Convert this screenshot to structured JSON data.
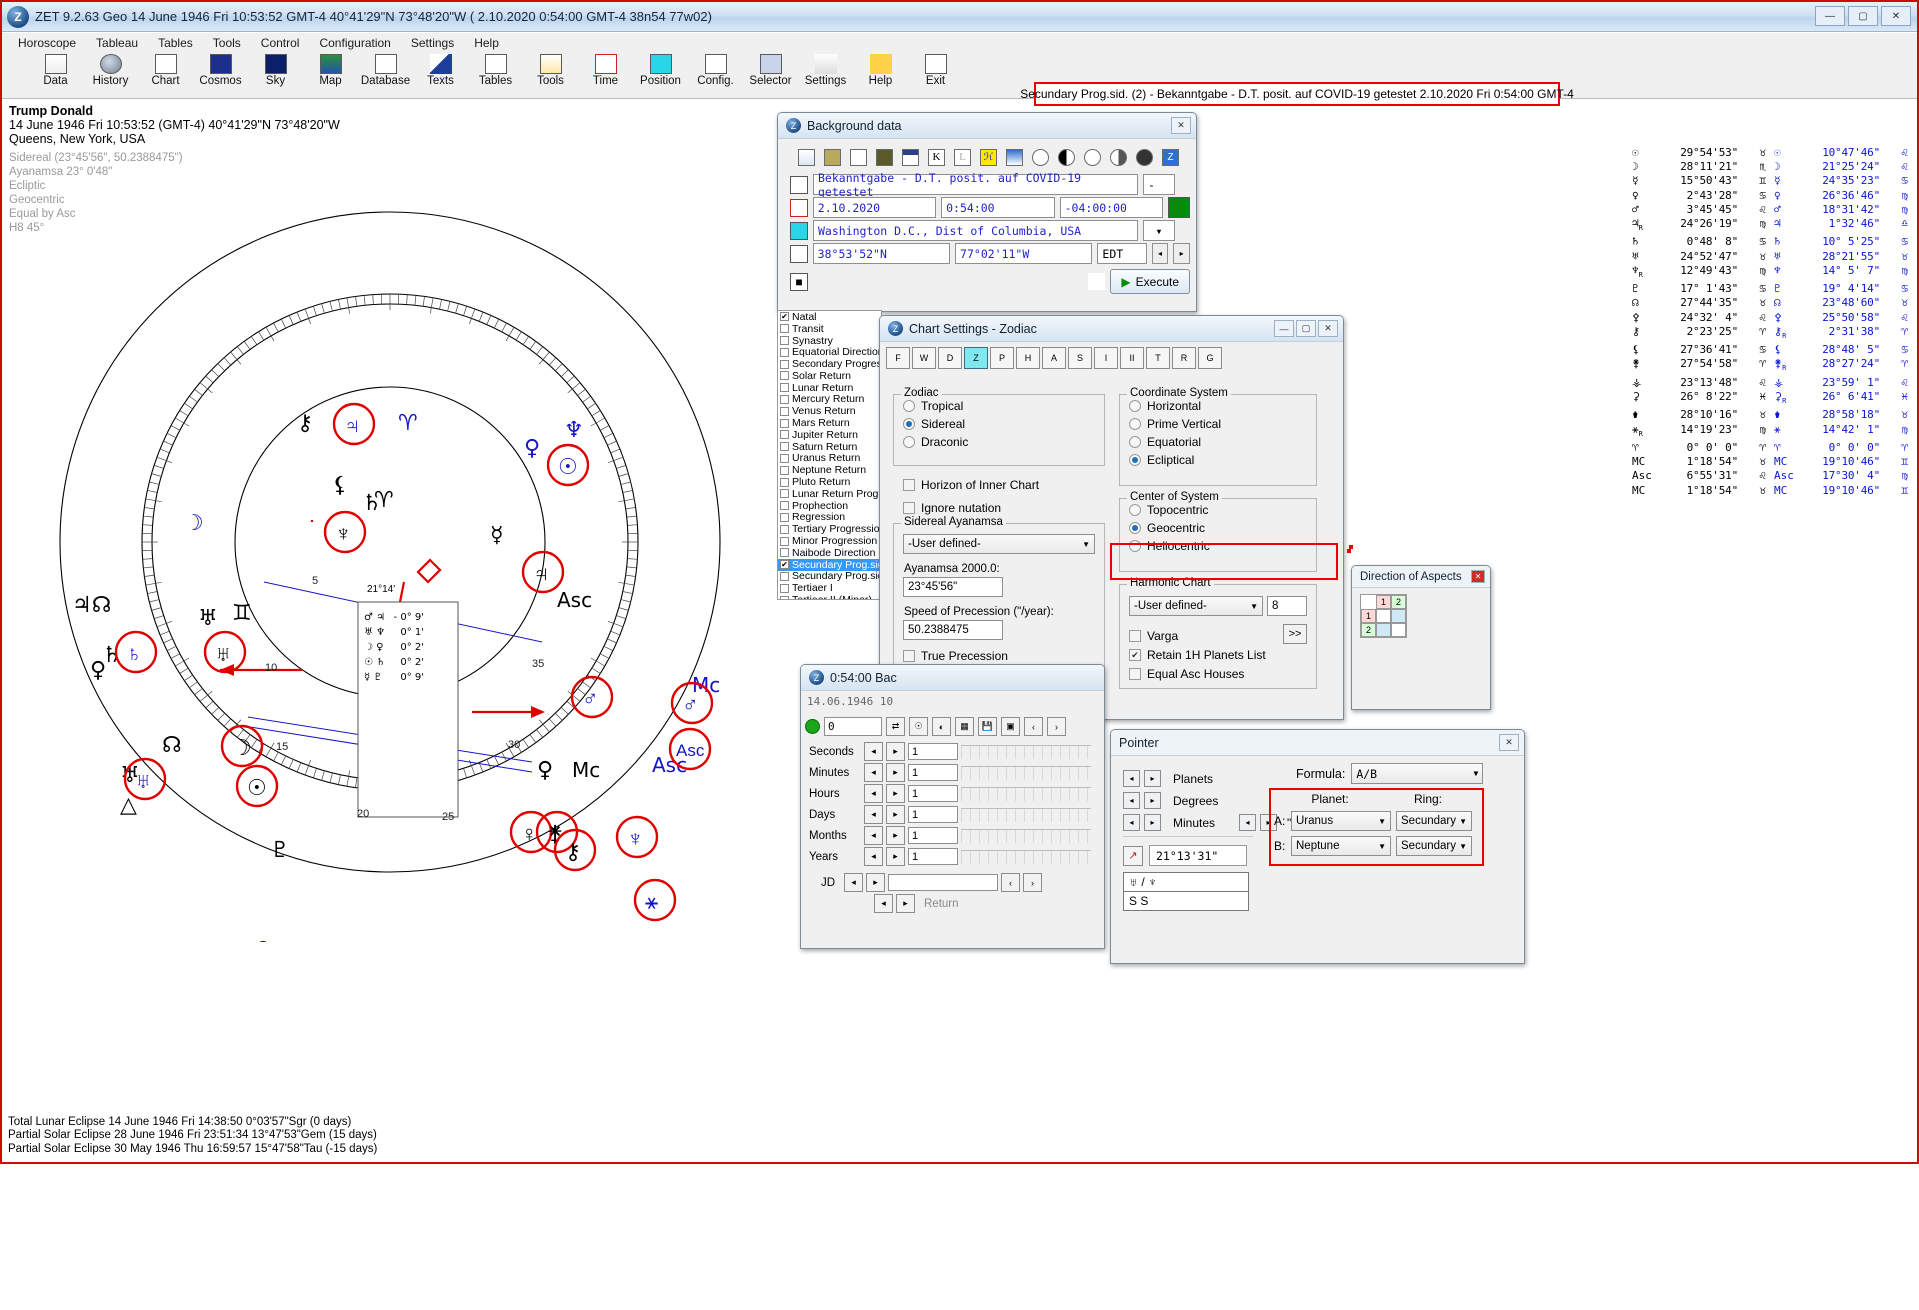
{
  "window": {
    "title": "ZET 9.2.63 Geo   14 June 1946  Fri  10:53:52 GMT-4 40°41'29\"N  73°48'20\"W  ( 2.10.2020   0:54:00 GMT-4 38n54 77w02)",
    "icon": "zet-logo-icon",
    "minimize": "—",
    "maximize": "▢",
    "close": "✕"
  },
  "menubar": {
    "items": [
      "Horoscope",
      "Tableau",
      "Tables",
      "Tools",
      "Control",
      "Configuration",
      "Settings",
      "Help"
    ]
  },
  "toolbar": {
    "items": [
      {
        "label": "Data",
        "icon": "grid-icon"
      },
      {
        "label": "History",
        "icon": "clock-history-icon"
      },
      {
        "label": "Chart",
        "icon": "chart-wheel-icon"
      },
      {
        "label": "Cosmos",
        "icon": "planet-icon"
      },
      {
        "label": "Sky",
        "icon": "starfield-icon"
      },
      {
        "label": "Map",
        "icon": "world-map-icon"
      },
      {
        "label": "Database",
        "icon": "database-icon"
      },
      {
        "label": "Texts",
        "icon": "pen-icon"
      },
      {
        "label": "Tables",
        "icon": "document-icon"
      },
      {
        "label": "Tools",
        "icon": "toolbox-icon"
      },
      {
        "label": "Time",
        "icon": "time-icon"
      },
      {
        "label": "Position",
        "icon": "position-icon"
      },
      {
        "label": "Config.",
        "icon": "config-icon"
      },
      {
        "label": "Selector",
        "icon": "selector-icon"
      },
      {
        "label": "Settings",
        "icon": "settings-icon"
      },
      {
        "label": "Help",
        "icon": "help-icon"
      },
      {
        "label": "Exit",
        "icon": "exit-icon"
      }
    ]
  },
  "chart_info": {
    "name": "Trump Donald",
    "datetime": "14 June 1946  Fri  10:53:52 (GMT-4) 40°41'29\"N  73°48'20\"W",
    "place": "Queens, New York, USA",
    "details": [
      "Sidereal (23°45'56\", 50.2388475\")",
      "Ayanamsa 23° 0'48\"",
      "Ecliptic",
      "Geocentric",
      "Equal by Asc",
      "H8  45°"
    ]
  },
  "banner": {
    "text": "Secundary Prog.sid. (2) - Bekanntgabe - D.T. posit. auf COVID-19 getestet  2.10.2020  Fri  0:54:00 GMT-4",
    "border_color": "#ee0000"
  },
  "background_data": {
    "title": "Background data",
    "close": "✕",
    "toolbar_icons": [
      "copy-icon",
      "paste-icon",
      "new-icon",
      "save-icon",
      "calendar-icon",
      "K-icon",
      "L-icon",
      "harmonic-icon",
      "flag-icon",
      "sun-icon",
      "moon-phase-icon",
      "circle-icon",
      "half-circle-icon",
      "filled-circle-icon",
      "Z-icon"
    ],
    "event_name": "Bekanntgabe - D.T. posit. auf COVID-19 getestet",
    "event_spin": "-",
    "date": "2.10.2020",
    "time": "0:54:00",
    "tz": "-04:00:00",
    "place": "Washington D.C., Dist of Columbia, USA",
    "lat": "38°53'52\"N",
    "lon": "77°02'11\"W",
    "dst": "EDT",
    "execute_label": "Execute",
    "color_swatch": "#0a8a0a"
  },
  "chart_types": {
    "items": [
      {
        "label": "Natal",
        "checked": true,
        "selected": false
      },
      {
        "label": "Transit",
        "checked": false,
        "selected": false
      },
      {
        "label": "Synastry",
        "checked": false,
        "selected": false
      },
      {
        "label": "Equatorial Direction",
        "checked": false,
        "selected": false
      },
      {
        "label": "Secondary Progression",
        "checked": false,
        "selected": false
      },
      {
        "label": "Solar Return",
        "checked": false,
        "selected": false
      },
      {
        "label": "Lunar Return",
        "checked": false,
        "selected": false
      },
      {
        "label": "Mercury Return",
        "checked": false,
        "selected": false
      },
      {
        "label": "Venus Return",
        "checked": false,
        "selected": false
      },
      {
        "label": "Mars Return",
        "checked": false,
        "selected": false
      },
      {
        "label": "Jupiter Return",
        "checked": false,
        "selected": false
      },
      {
        "label": "Saturn Return",
        "checked": false,
        "selected": false
      },
      {
        "label": "Uranus Return",
        "checked": false,
        "selected": false
      },
      {
        "label": "Neptune Return",
        "checked": false,
        "selected": false
      },
      {
        "label": "Pluto Return",
        "checked": false,
        "selected": false
      },
      {
        "label": "Lunar Return Progression",
        "checked": false,
        "selected": false
      },
      {
        "label": "Prophection",
        "checked": false,
        "selected": false
      },
      {
        "label": "Regression",
        "checked": false,
        "selected": false
      },
      {
        "label": "Tertiary Progression",
        "checked": false,
        "selected": false
      },
      {
        "label": "Minor Progression",
        "checked": false,
        "selected": false
      },
      {
        "label": "Naibode Direction",
        "checked": false,
        "selected": false
      },
      {
        "label": "Secundary Prog.sid.",
        "checked": true,
        "selected": true
      },
      {
        "label": "Secundary Prog.sid-c",
        "checked": false,
        "selected": false
      },
      {
        "label": "Tertiaer I",
        "checked": false,
        "selected": false
      },
      {
        "label": "Tertiaer II (Minor)",
        "checked": false,
        "selected": false
      }
    ]
  },
  "chart_settings": {
    "title": "Chart Settings - Zodiac",
    "minimize": "—",
    "maximize": "▢",
    "close": "✕",
    "tabs": [
      {
        "name": "F",
        "icon": "chart-f-icon",
        "selected": false
      },
      {
        "name": "W",
        "icon": "chart-w-icon",
        "selected": false
      },
      {
        "name": "D",
        "icon": "chart-d-icon",
        "selected": false
      },
      {
        "name": "Z",
        "icon": "zodiac-z-icon",
        "selected": true
      },
      {
        "name": "P",
        "icon": "planets-p-icon",
        "selected": false
      },
      {
        "name": "H",
        "icon": "houses-h-icon",
        "selected": false
      },
      {
        "name": "A",
        "icon": "aspects-a-icon",
        "selected": false
      },
      {
        "name": "S",
        "icon": "orbs-s-icon",
        "selected": false
      },
      {
        "name": "I",
        "icon": "interface-i-icon",
        "selected": false
      },
      {
        "name": "II",
        "icon": "colors-icon",
        "selected": false
      },
      {
        "name": "T",
        "icon": "text-t-icon",
        "selected": false
      },
      {
        "name": "R",
        "icon": "rings-r-icon",
        "selected": false
      },
      {
        "name": "G",
        "icon": "graph-g-icon",
        "selected": false
      }
    ],
    "zodiac": {
      "legend": "Zodiac",
      "options": [
        {
          "label": "Tropical",
          "selected": false
        },
        {
          "label": "Sidereal",
          "selected": true
        },
        {
          "label": "Draconic",
          "selected": false
        }
      ]
    },
    "horizon_inner_chart": {
      "label": "Horizon of Inner Chart",
      "checked": false
    },
    "ignore_nutation": {
      "label": "Ignore nutation",
      "checked": false
    },
    "sidereal_ayanamsa": {
      "legend": "Sidereal Ayanamsa",
      "select_value": "-User defined-",
      "ayanamsa_label": "Ayanamsa 2000.0:",
      "ayanamsa_value": "23°45'56\"",
      "precession_label": "Speed of Precession (\"/year):",
      "precession_value": "50.2388475",
      "true_precession": {
        "label": "True Precession",
        "checked": false
      }
    },
    "coordinate_system": {
      "legend": "Coordinate System",
      "options": [
        {
          "label": "Horizontal",
          "selected": false
        },
        {
          "label": "Prime Vertical",
          "selected": false
        },
        {
          "label": "Equatorial",
          "selected": false
        },
        {
          "label": "Ecliptical",
          "selected": true
        }
      ]
    },
    "center_of_system": {
      "legend": "Center of System",
      "options": [
        {
          "label": "Topocentric",
          "selected": false
        },
        {
          "label": "Geocentric",
          "selected": true
        },
        {
          "label": "Heliocentric",
          "selected": false
        }
      ]
    },
    "harmonic_chart": {
      "legend": "Harmonic Chart",
      "select_value": "-User defined-",
      "harmonic_value": "8",
      "more_button": ">>",
      "varga": {
        "label": "Varga",
        "checked": false
      },
      "retain_1h": {
        "label": "Retain 1H Planets List",
        "checked": true
      },
      "equal_asc": {
        "label": "Equal Asc Houses",
        "checked": false
      }
    }
  },
  "time_step": {
    "title": "0:54:00 Bac",
    "date_line": "14.06.1946  10",
    "step_value": "0",
    "rows": [
      {
        "label": "Seconds",
        "value": "1"
      },
      {
        "label": "Minutes",
        "value": "1"
      },
      {
        "label": "Hours",
        "value": "1"
      },
      {
        "label": "Days",
        "value": "1"
      },
      {
        "label": "Months",
        "value": "1"
      },
      {
        "label": "Years",
        "value": "1"
      }
    ],
    "jd_label": "JD",
    "jd_value": "",
    "return_label": "Return"
  },
  "direction_of_aspects": {
    "title": "Direction of Aspects",
    "close": "✕",
    "col_headers": [
      "1",
      "2"
    ],
    "rows": [
      {
        "header": "1",
        "cells": [
          "",
          ""
        ]
      },
      {
        "header": "2",
        "cells": [
          "",
          ""
        ]
      }
    ]
  },
  "pointer": {
    "title": "Pointer",
    "close": "✕",
    "steppers": [
      "Planets",
      "Degrees",
      "Minutes"
    ],
    "minutes_unit": "\"",
    "position_value": "21°13'31\"",
    "pair_symbols": "♅ / ♆",
    "pair_rings": "S   S",
    "formula_label": "Formula:",
    "formula_value": "A/B",
    "planet_header": "Planet:",
    "ring_header": "Ring:",
    "rows": [
      {
        "key": "A:",
        "planet": "Uranus",
        "ring": "Secundary"
      },
      {
        "key": "B:",
        "planet": "Neptune",
        "ring": "Secundary"
      }
    ]
  },
  "planets_table": {
    "rows": [
      {
        "sym": "☉",
        "r1": false,
        "v1": "29°54'53\"",
        "s1": "♉",
        "v2": "10°47'46\"",
        "s2": "♌",
        "r2": false
      },
      {
        "sym": "☽",
        "r1": false,
        "v1": "28°11'21\"",
        "s1": "♏",
        "v2": "21°25'24\"",
        "s2": "♌",
        "r2": false
      },
      {
        "sym": "☿",
        "r1": false,
        "v1": "15°50'43\"",
        "s1": "♊",
        "v2": "24°35'23\"",
        "s2": "♋",
        "r2": false
      },
      {
        "sym": "♀",
        "r1": false,
        "v1": "2°43'28\"",
        "s1": "♋",
        "v2": "26°36'46\"",
        "s2": "♍",
        "r2": false
      },
      {
        "sym": "♂",
        "r1": false,
        "v1": "3°45'45\"",
        "s1": "♌",
        "v2": "18°31'42\"",
        "s2": "♍",
        "r2": false
      },
      {
        "sym": "♃",
        "r1": true,
        "v1": "24°26'19\"",
        "s1": "♍",
        "v2": "1°32'46\"",
        "s2": "♎",
        "r2": false
      },
      {
        "sym": "♄",
        "r1": false,
        "v1": "0°48' 8\"",
        "s1": "♋",
        "v2": "10° 5'25\"",
        "s2": "♋",
        "r2": false
      },
      {
        "sym": "♅",
        "r1": false,
        "v1": "24°52'47\"",
        "s1": "♉",
        "v2": "28°21'55\"",
        "s2": "♉",
        "r2": false
      },
      {
        "sym": "♆",
        "r1": true,
        "v1": "12°49'43\"",
        "s1": "♍",
        "v2": "14° 5' 7\"",
        "s2": "♍",
        "r2": false
      },
      {
        "sym": "♇",
        "r1": false,
        "v1": "17° 1'43\"",
        "s1": "♋",
        "v2": "19° 4'14\"",
        "s2": "♋",
        "r2": false
      },
      {
        "sym": "☊",
        "r1": false,
        "v1": "27°44'35\"",
        "s1": "♉",
        "v2": "23°48'60\"",
        "s2": "♉",
        "r2": false
      },
      {
        "sym": "⚴",
        "r1": false,
        "v1": "24°32' 4\"",
        "s1": "♌",
        "v2": "25°50'58\"",
        "s2": "♌",
        "r2": false
      },
      {
        "sym": "⚷",
        "r1": false,
        "v1": "2°23'25\"",
        "s1": "♈",
        "v2": "2°31'38\"",
        "s2": "♈",
        "r2": true
      },
      {
        "sym": "⚸",
        "r1": false,
        "v1": "27°36'41\"",
        "s1": "♋",
        "v2": "28°48' 5\"",
        "s2": "♋",
        "r2": false
      },
      {
        "sym": "⚵",
        "r1": false,
        "v1": "27°54'58\"",
        "s1": "♈",
        "v2": "28°27'24\"",
        "s2": "♈",
        "r2": true
      },
      {
        "sym": "⚶",
        "r1": false,
        "v1": "23°13'48\"",
        "s1": "♌",
        "v2": "23°59' 1\"",
        "s2": "♌",
        "r2": false
      },
      {
        "sym": "⚳",
        "r1": false,
        "v1": "26° 8'22\"",
        "s1": "♓",
        "v2": "26° 6'41\"",
        "s2": "♓",
        "r2": true
      },
      {
        "sym": "⚱",
        "r1": false,
        "v1": "28°10'16\"",
        "s1": "♉",
        "v2": "28°58'18\"",
        "s2": "♉",
        "r2": false
      },
      {
        "sym": "⚹",
        "r1": true,
        "v1": "14°19'23\"",
        "s1": "♍",
        "v2": "14°42' 1\"",
        "s2": "♍",
        "r2": false
      },
      {
        "sym": "♈",
        "r1": false,
        "v1": "0° 0' 0\"",
        "s1": "♈",
        "v2": "0° 0' 0\"",
        "s2": "♈",
        "r2": false
      },
      {
        "sym": "MC",
        "r1": false,
        "v1": "1°18'54\"",
        "s1": "♉",
        "v2": "19°10'46\"",
        "s2": "♊",
        "r2": false
      },
      {
        "sym": "Asc",
        "r1": false,
        "v1": "6°55'31\"",
        "s1": "♌",
        "v2": "17°30' 4\"",
        "s2": "♍",
        "r2": false
      },
      {
        "sym": "MC",
        "r1": false,
        "v1": "1°18'54\"",
        "s1": "♉",
        "v2": "19°10'46\"",
        "s2": "♊",
        "r2": false
      }
    ]
  },
  "eclipses": {
    "lines": [
      "Total Lunar Eclipse 14 June 1946 Fri 14:38:50  0°03'57\"Sgr (0 days)",
      "Partial Solar Eclipse 28 June 1946 Fri 23:51:34 13°47'53\"Gem (15 days)",
      "Partial Solar Eclipse 30 May 1946 Thu 16:59:57 15°47'58\"Tau (-15 days)"
    ]
  },
  "wheel": {
    "inner_label": "21°14'",
    "asc_label": "Asc",
    "mc_label": "Mc",
    "degree_marks": [
      "5",
      "10",
      "15",
      "20",
      "25",
      "30",
      "35"
    ],
    "tooltip_rows": [
      {
        "sym": "♂ ♃",
        "val": "- 0° 9'"
      },
      {
        "sym": "♅ ♆",
        "val": "0° 1'"
      },
      {
        "sym": "☽ ♀",
        "val": "0° 2'"
      },
      {
        "sym": "☉ ♄",
        "val": "0° 2'"
      },
      {
        "sym": "☿ ♇",
        "val": "0° 9'"
      }
    ]
  }
}
